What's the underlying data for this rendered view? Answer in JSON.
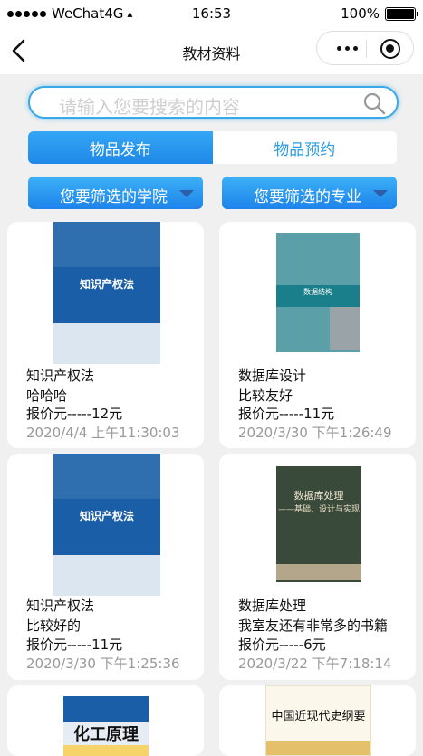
{
  "status_bar": {
    "carrier": "WeChat4G",
    "time": "16:53",
    "battery_text": "100%"
  },
  "nav": {
    "title": "教材资料"
  },
  "search": {
    "placeholder": "请输入您要搜索的内容"
  },
  "tabs": [
    {
      "label": "物品发布"
    },
    {
      "label": "物品预约"
    }
  ],
  "filters": [
    {
      "label": "您要筛选的学院"
    },
    {
      "label": "您要筛选的专业"
    }
  ],
  "cards": [
    {
      "name": "知识产权法",
      "desc": "哈哈哈",
      "price": "报价元-----12元",
      "time": "2020/4/4 上午11:30:03",
      "cover_title": "知识产权法"
    },
    {
      "name": "数据库设计",
      "desc": "比较友好",
      "price": "报价元-----11元",
      "time": "2020/3/30 下午1:26:49",
      "cover_title": "数据结构"
    },
    {
      "name": "知识产权法",
      "desc": "比较好的",
      "price": "报价元-----11元",
      "time": "2020/3/30 下午1:25:36",
      "cover_title": "知识产权法"
    },
    {
      "name": "数据库处理",
      "desc": "我室友还有非常多的书籍",
      "price": "报价元-----6元",
      "time": "2020/3/22 下午7:18:14",
      "cover_title": "数据库处理",
      "cover_subtitle": "——基础、设计与实现"
    },
    {
      "cover_title": "化工原理"
    },
    {
      "cover_title": "中国近现代史纲要"
    }
  ]
}
